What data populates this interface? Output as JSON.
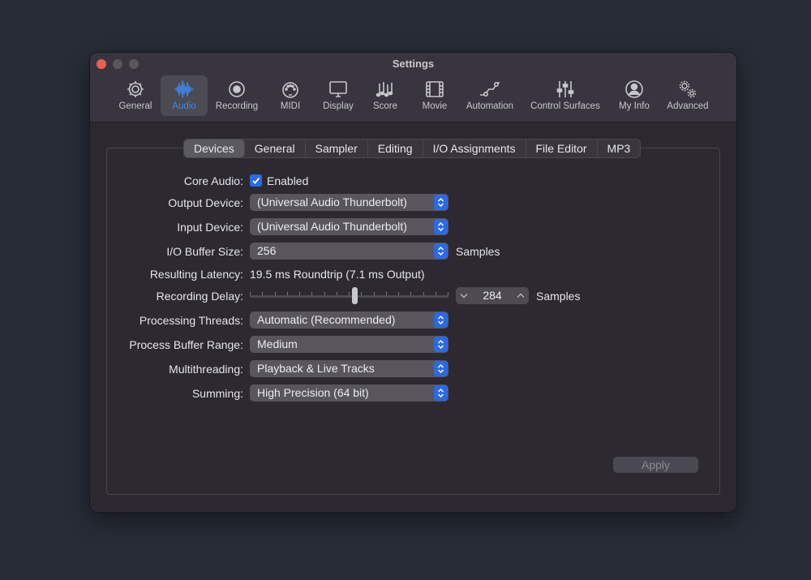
{
  "window": {
    "title": "Settings"
  },
  "toolbar": {
    "items": [
      {
        "label": "General",
        "icon": "gear-icon"
      },
      {
        "label": "Audio",
        "icon": "waveform-icon"
      },
      {
        "label": "Recording",
        "icon": "record-icon"
      },
      {
        "label": "MIDI",
        "icon": "midi-port-icon"
      },
      {
        "label": "Display",
        "icon": "monitor-icon"
      },
      {
        "label": "Score",
        "icon": "music-notes-icon"
      },
      {
        "label": "Movie",
        "icon": "film-icon"
      },
      {
        "label": "Automation",
        "icon": "automation-curve-icon"
      },
      {
        "label": "Control Surfaces",
        "icon": "faders-icon"
      },
      {
        "label": "My Info",
        "icon": "person-icon"
      },
      {
        "label": "Advanced",
        "icon": "gears-icon"
      }
    ],
    "active": "Audio"
  },
  "tabs": [
    "Devices",
    "General",
    "Sampler",
    "Editing",
    "I/O Assignments",
    "File Editor",
    "MP3"
  ],
  "active_tab": "Devices",
  "form": {
    "core_audio": {
      "label": "Core Audio:",
      "value": "Enabled",
      "checked": true
    },
    "output_device": {
      "label": "Output Device:",
      "value": "(Universal Audio Thunderbolt)"
    },
    "input_device": {
      "label": "Input Device:",
      "value": "(Universal Audio Thunderbolt)"
    },
    "buffer_size": {
      "label": "I/O Buffer Size:",
      "value": "256",
      "unit": "Samples"
    },
    "latency": {
      "label": "Resulting Latency:",
      "value": "19.5 ms Roundtrip (7.1 ms Output)"
    },
    "recording_delay": {
      "label": "Recording Delay:",
      "value": "284",
      "unit": "Samples",
      "slider_fraction": 0.53
    },
    "processing_threads": {
      "label": "Processing Threads:",
      "value": "Automatic (Recommended)"
    },
    "process_buffer_range": {
      "label": "Process Buffer Range:",
      "value": "Medium"
    },
    "multithreading": {
      "label": "Multithreading:",
      "value": "Playback & Live Tracks"
    },
    "summing": {
      "label": "Summing:",
      "value": "High Precision (64 bit)"
    }
  },
  "apply_label": "Apply",
  "colors": {
    "accent": "#2a6ae8",
    "active_icon": "#3b8cf5",
    "close": "#ee5e57"
  }
}
